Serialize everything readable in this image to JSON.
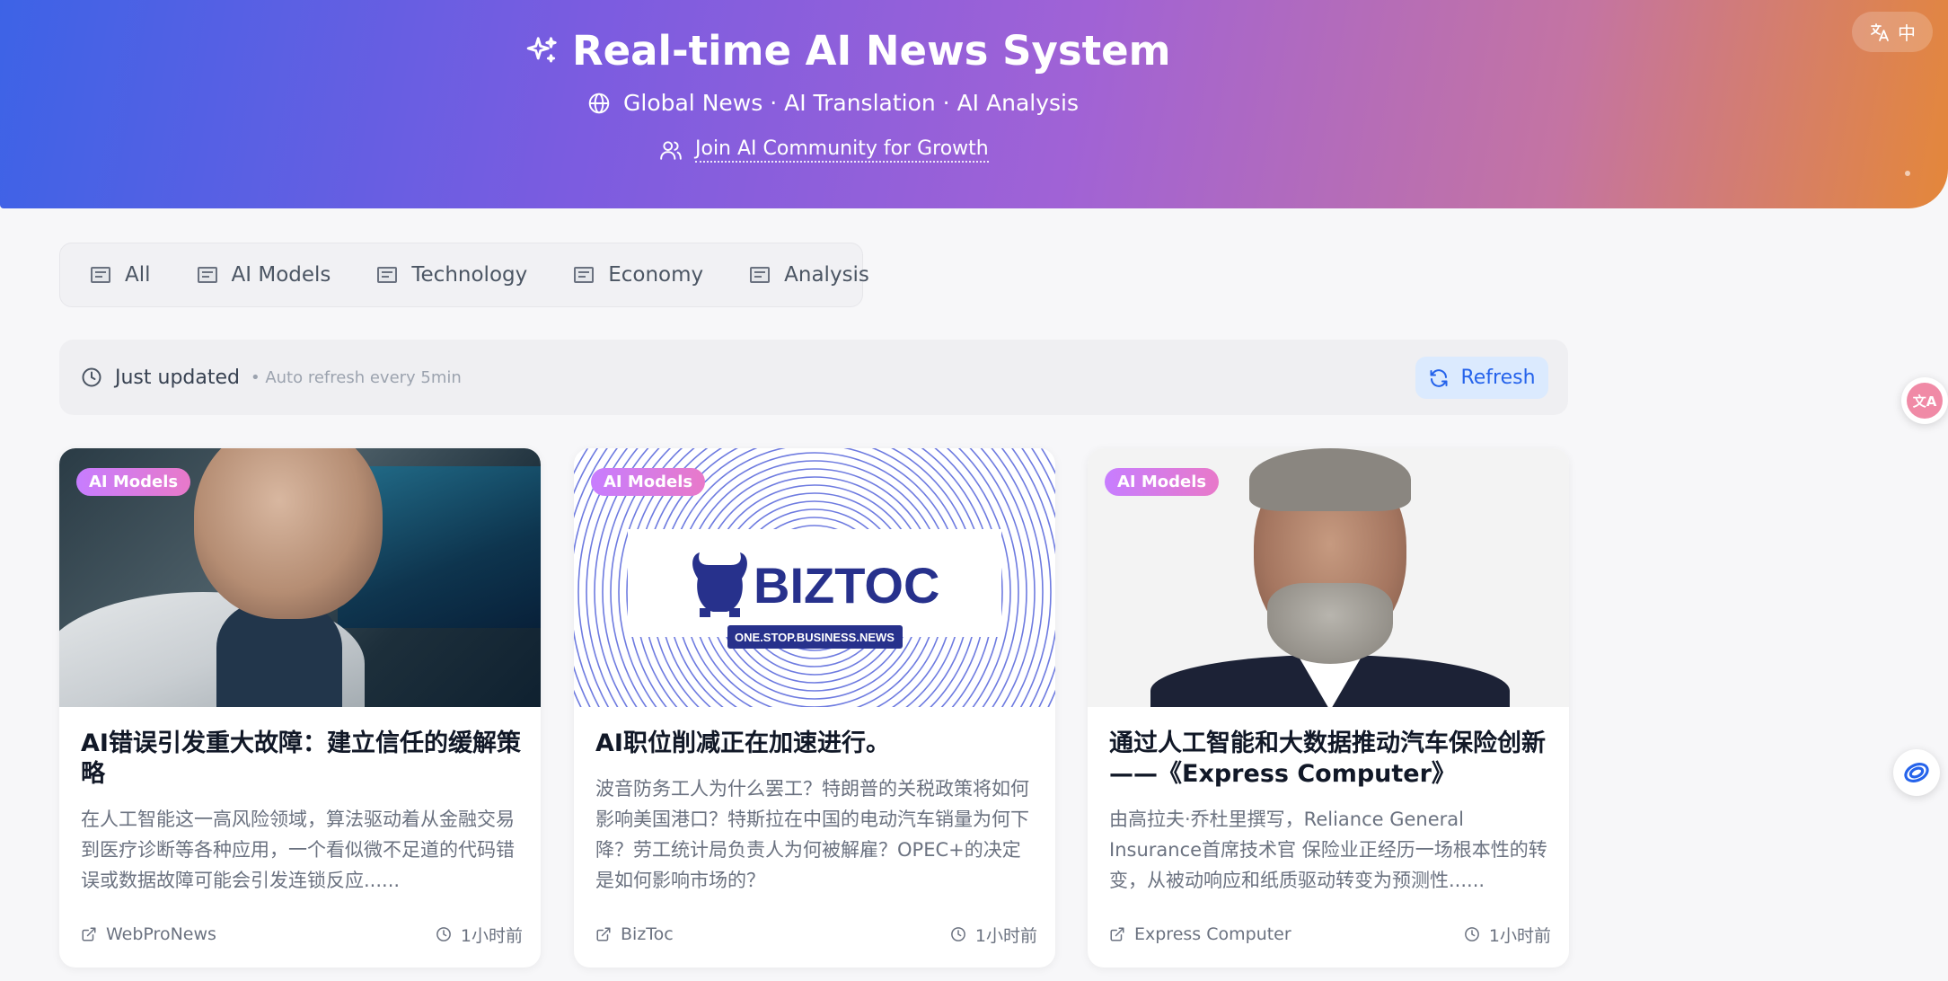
{
  "header": {
    "title": "Real-time AI News System",
    "subtitle": "Global News · AI Translation · AI Analysis",
    "community_link": "Join AI Community for Growth",
    "lang_toggle": "中"
  },
  "tabs": [
    {
      "label": "All"
    },
    {
      "label": "AI Models"
    },
    {
      "label": "Technology"
    },
    {
      "label": "Economy"
    },
    {
      "label": "Analysis"
    }
  ],
  "status": {
    "updated": "Just updated",
    "auto_refresh": "• Auto refresh every 5min",
    "refresh_label": "Refresh"
  },
  "cards": [
    {
      "badge": "AI Models",
      "title": "AI错误引发重大故障：建立信任的缓解策略",
      "description": "在人工智能这一高风险领域，算法驱动着从金融交易到医疗诊断等各种应用，一个看似微不足道的代码错误或数据故障可能会引发连锁反应......",
      "source": "WebProNews",
      "time": "1小时前"
    },
    {
      "badge": "AI Models",
      "title": "AI职位削减正在加速进行。",
      "description": "波音防务工人为什么罢工？特朗普的关税政策将如何影响美国港口？特斯拉在中国的电动汽车销量为何下降？劳工统计局负责人为何被解雇？OPEC+的决定是如何影响市场的？",
      "source": "BizToc",
      "time": "1小时前",
      "image_logo": "BIZTOC",
      "image_tagline": "ONE.STOP.BUSINESS.NEWS"
    },
    {
      "badge": "AI Models",
      "title": "通过人工智能和大数据推动汽车保险创新——《Express Computer》",
      "description": "由高拉夫·乔杜里撰写，Reliance General Insurance首席技术官 保险业正经历一场根本性的转变，从被动响应和纸质驱动转变为预测性......",
      "source": "Express Computer",
      "time": "1小时前"
    }
  ],
  "colors": {
    "accent": "#2563eb",
    "badge": "#d17ae6",
    "header_start": "#3d63e6",
    "header_end": "#e4873a"
  },
  "icons": {
    "title": "sparkles-icon",
    "subtitle": "globe-icon",
    "community": "users-icon",
    "lang": "translate-icon",
    "tab": "newspaper-icon",
    "status": "clock-icon",
    "refresh": "refresh-icon",
    "source": "external-link-icon",
    "time": "clock-icon"
  }
}
